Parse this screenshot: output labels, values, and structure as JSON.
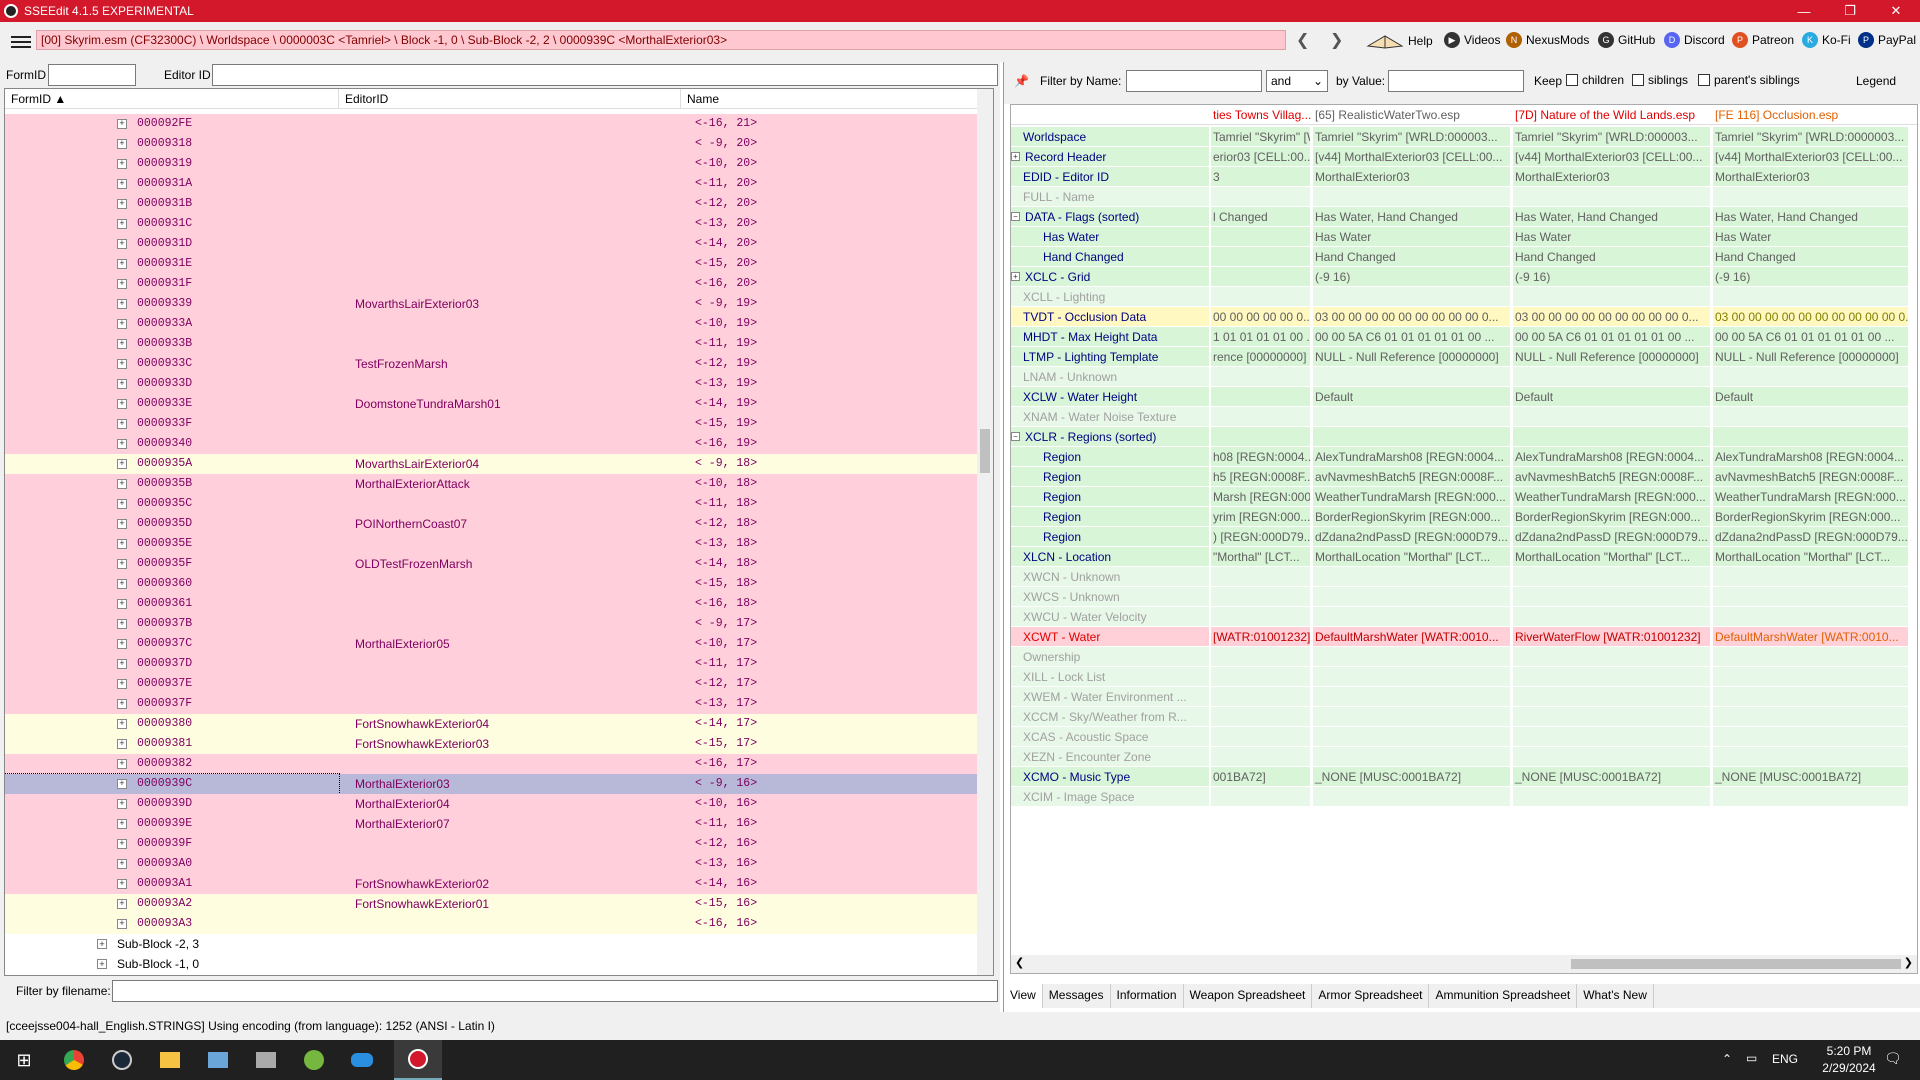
{
  "window": {
    "title": "SSEEdit 4.1.5 EXPERIMENTAL",
    "minimize": "—",
    "maximize": "❐",
    "close": "✕"
  },
  "toolbar": {
    "path": "[00] Skyrim.esm (CF32300C) \\ Worldspace \\ 0000003C <Tamriel> \\ Block -1, 0 \\ Sub-Block -2, 2 \\ 0000939C <MorthalExterior03>",
    "back": "❮",
    "forward": "❯",
    "help": "Help",
    "videos": "Videos",
    "nexus": "NexusMods",
    "github": "GitHub",
    "discord": "Discord",
    "patreon": "Patreon",
    "kofi": "Ko-Fi",
    "paypal": "PayPal"
  },
  "left": {
    "formid_label": "FormID",
    "editorid_label": "Editor ID",
    "col_formid": "FormID ▲",
    "col_editorid": "EditorID",
    "col_name": "Name",
    "rows": [
      {
        "id": "000092FE",
        "eid": "",
        "name": "<-16, 21>",
        "c": "pink"
      },
      {
        "id": "00009318",
        "eid": "",
        "name": "< -9, 20>",
        "c": "pink"
      },
      {
        "id": "00009319",
        "eid": "",
        "name": "<-10, 20>",
        "c": "pink"
      },
      {
        "id": "0000931A",
        "eid": "",
        "name": "<-11, 20>",
        "c": "pink"
      },
      {
        "id": "0000931B",
        "eid": "",
        "name": "<-12, 20>",
        "c": "pink"
      },
      {
        "id": "0000931C",
        "eid": "",
        "name": "<-13, 20>",
        "c": "pink"
      },
      {
        "id": "0000931D",
        "eid": "",
        "name": "<-14, 20>",
        "c": "pink"
      },
      {
        "id": "0000931E",
        "eid": "",
        "name": "<-15, 20>",
        "c": "pink"
      },
      {
        "id": "0000931F",
        "eid": "",
        "name": "<-16, 20>",
        "c": "pink"
      },
      {
        "id": "00009339",
        "eid": "MovarthsLairExterior03",
        "name": "< -9, 19>",
        "c": "pink"
      },
      {
        "id": "0000933A",
        "eid": "",
        "name": "<-10, 19>",
        "c": "pink"
      },
      {
        "id": "0000933B",
        "eid": "",
        "name": "<-11, 19>",
        "c": "pink"
      },
      {
        "id": "0000933C",
        "eid": "TestFrozenMarsh",
        "name": "<-12, 19>",
        "c": "pink"
      },
      {
        "id": "0000933D",
        "eid": "",
        "name": "<-13, 19>",
        "c": "pink"
      },
      {
        "id": "0000933E",
        "eid": "DoomstoneTundraMarsh01",
        "name": "<-14, 19>",
        "c": "pink"
      },
      {
        "id": "0000933F",
        "eid": "",
        "name": "<-15, 19>",
        "c": "pink"
      },
      {
        "id": "00009340",
        "eid": "",
        "name": "<-16, 19>",
        "c": "pink"
      },
      {
        "id": "0000935A",
        "eid": "MovarthsLairExterior04",
        "name": "< -9, 18>",
        "c": "yellow"
      },
      {
        "id": "0000935B",
        "eid": "MorthalExteriorAttack",
        "name": "<-10, 18>",
        "c": "pink"
      },
      {
        "id": "0000935C",
        "eid": "",
        "name": "<-11, 18>",
        "c": "pink"
      },
      {
        "id": "0000935D",
        "eid": "POINorthernCoast07",
        "name": "<-12, 18>",
        "c": "pink"
      },
      {
        "id": "0000935E",
        "eid": "",
        "name": "<-13, 18>",
        "c": "pink"
      },
      {
        "id": "0000935F",
        "eid": "OLDTestFrozenMarsh",
        "name": "<-14, 18>",
        "c": "pink"
      },
      {
        "id": "00009360",
        "eid": "",
        "name": "<-15, 18>",
        "c": "pink"
      },
      {
        "id": "00009361",
        "eid": "",
        "name": "<-16, 18>",
        "c": "pink"
      },
      {
        "id": "0000937B",
        "eid": "",
        "name": "< -9, 17>",
        "c": "pink"
      },
      {
        "id": "0000937C",
        "eid": "MorthalExterior05",
        "name": "<-10, 17>",
        "c": "pink"
      },
      {
        "id": "0000937D",
        "eid": "",
        "name": "<-11, 17>",
        "c": "pink"
      },
      {
        "id": "0000937E",
        "eid": "",
        "name": "<-12, 17>",
        "c": "pink"
      },
      {
        "id": "0000937F",
        "eid": "",
        "name": "<-13, 17>",
        "c": "pink"
      },
      {
        "id": "00009380",
        "eid": "FortSnowhawkExterior04",
        "name": "<-14, 17>",
        "c": "yellow"
      },
      {
        "id": "00009381",
        "eid": "FortSnowhawkExterior03",
        "name": "<-15, 17>",
        "c": "yellow"
      },
      {
        "id": "00009382",
        "eid": "",
        "name": "<-16, 17>",
        "c": "pink"
      },
      {
        "id": "0000939C",
        "eid": "MorthalExterior03",
        "name": "< -9, 16>",
        "c": "selected"
      },
      {
        "id": "0000939D",
        "eid": "MorthalExterior04",
        "name": "<-10, 16>",
        "c": "pink"
      },
      {
        "id": "0000939E",
        "eid": "MorthalExterior07",
        "name": "<-11, 16>",
        "c": "pink"
      },
      {
        "id": "0000939F",
        "eid": "",
        "name": "<-12, 16>",
        "c": "pink"
      },
      {
        "id": "000093A0",
        "eid": "",
        "name": "<-13, 16>",
        "c": "pink"
      },
      {
        "id": "000093A1",
        "eid": "FortSnowhawkExterior02",
        "name": "<-14, 16>",
        "c": "pink"
      },
      {
        "id": "000093A2",
        "eid": "FortSnowhawkExterior01",
        "name": "<-15, 16>",
        "c": "yellow"
      },
      {
        "id": "000093A3",
        "eid": "",
        "name": "<-16, 16>",
        "c": "yellow"
      }
    ],
    "subblocks": [
      "Sub-Block -2, 3",
      "Sub-Block -1, 0"
    ],
    "filter_label": "Filter by filename:"
  },
  "right": {
    "filter_name_label": "Filter by Name:",
    "and_select": "and",
    "by_value_label": "by Value:",
    "keep_label": "Keep",
    "children": "children",
    "siblings": "siblings",
    "parents_siblings": "parent's siblings",
    "legend": "Legend",
    "headers": [
      "ties Towns Villag...",
      "[65] RealisticWaterTwo.esp",
      "[7D] Nature of the Wild Lands.esp",
      "[FE 116] Occlusion.esp"
    ],
    "header_colors": [
      "#e00000",
      "#606060",
      "#e00000",
      "#e06000"
    ],
    "rows": [
      {
        "label": "Worldspace",
        "ind": 0,
        "exp": "",
        "v": [
          "Tamriel \"Skyrim\" [WRLD:0000003...",
          "Tamriel \"Skyrim\" [WRLD:000003...",
          "Tamriel \"Skyrim\" [WRLD:000003...",
          "Tamriel \"Skyrim\" [WRLD:0000003..."
        ],
        "bg": "#d8f5d8",
        "lc": "#000080",
        "vc": "#606060"
      },
      {
        "label": "Record Header",
        "ind": 0,
        "exp": "+",
        "v": [
          "erior03 [CELL:00...",
          "[v44] MorthalExterior03 [CELL:00...",
          "[v44] MorthalExterior03 [CELL:00...",
          "[v44] MorthalExterior03 [CELL:00..."
        ],
        "bg": "#d8f5d8",
        "lc": "#000080",
        "vc": "#606060"
      },
      {
        "label": "EDID - Editor ID",
        "ind": 0,
        "exp": "",
        "v": [
          "3",
          "MorthalExterior03",
          "MorthalExterior03",
          "MorthalExterior03"
        ],
        "bg": "#d8f5d8",
        "lc": "#000080",
        "vc": "#606060"
      },
      {
        "label": "FULL - Name",
        "ind": 0,
        "exp": "",
        "v": [
          "",
          "",
          "",
          ""
        ],
        "bg": "#e8f8e8",
        "lc": "#a0a0a0",
        "vc": "#606060"
      },
      {
        "label": "DATA - Flags (sorted)",
        "ind": 0,
        "exp": "-",
        "v": [
          "l Changed",
          "Has Water, Hand Changed",
          "Has Water, Hand Changed",
          "Has Water, Hand Changed"
        ],
        "bg": "#d8f5d8",
        "lc": "#000080",
        "vc": "#606060"
      },
      {
        "label": "Has Water",
        "ind": 1,
        "exp": "",
        "v": [
          "",
          "Has Water",
          "Has Water",
          "Has Water"
        ],
        "bg": "#d8f5d8",
        "lc": "#000080",
        "vc": "#606060"
      },
      {
        "label": "Hand Changed",
        "ind": 1,
        "exp": "",
        "v": [
          "",
          "Hand Changed",
          "Hand Changed",
          "Hand Changed"
        ],
        "bg": "#d8f5d8",
        "lc": "#000080",
        "vc": "#606060"
      },
      {
        "label": "XCLC - Grid",
        "ind": 0,
        "exp": "+",
        "v": [
          "",
          "(-9 16)",
          "(-9 16)",
          "(-9 16)"
        ],
        "bg": "#d8f5d8",
        "lc": "#000080",
        "vc": "#606060"
      },
      {
        "label": "XCLL - Lighting",
        "ind": 0,
        "exp": "",
        "v": [
          "",
          "",
          "",
          ""
        ],
        "bg": "#e8f8e8",
        "lc": "#a0a0a0",
        "vc": "#606060"
      },
      {
        "label": "TVDT - Occlusion Data",
        "ind": 0,
        "exp": "",
        "v": [
          "00 00 00 00 00 0...",
          "03 00 00 00 00 00 00 00 00 00 0...",
          "03 00 00 00 00 00 00 00 00 00 0...",
          "03 00 00 00 00 00 00 00 00 00 00 0..."
        ],
        "bg": "#fff8c0",
        "lc": "#000080",
        "vc": "#606060",
        "lastc": "#808000"
      },
      {
        "label": "MHDT - Max Height Data",
        "ind": 0,
        "exp": "",
        "v": [
          "1 01 01 01 01 00 ...",
          "00 00 5A C6 01 01 01 01 01 00 ...",
          "00 00 5A C6 01 01 01 01 01 00 ...",
          "00 00 5A C6 01 01 01 01 01 00 ..."
        ],
        "bg": "#d8f5d8",
        "lc": "#000080",
        "vc": "#606060"
      },
      {
        "label": "LTMP - Lighting Template",
        "ind": 0,
        "exp": "",
        "v": [
          "rence [00000000]",
          "NULL - Null Reference [00000000]",
          "NULL - Null Reference [00000000]",
          "NULL - Null Reference [00000000]"
        ],
        "bg": "#d8f5d8",
        "lc": "#000080",
        "vc": "#606060"
      },
      {
        "label": "LNAM - Unknown",
        "ind": 0,
        "exp": "",
        "v": [
          "",
          "",
          "",
          ""
        ],
        "bg": "#e8f8e8",
        "lc": "#a0a0a0",
        "vc": "#606060"
      },
      {
        "label": "XCLW - Water Height",
        "ind": 0,
        "exp": "",
        "v": [
          "",
          "Default",
          "Default",
          "Default"
        ],
        "bg": "#d8f5d8",
        "lc": "#000080",
        "vc": "#606060"
      },
      {
        "label": "XNAM - Water Noise Texture",
        "ind": 0,
        "exp": "",
        "v": [
          "",
          "",
          "",
          ""
        ],
        "bg": "#e8f8e8",
        "lc": "#a0a0a0",
        "vc": "#606060"
      },
      {
        "label": "XCLR - Regions (sorted)",
        "ind": 0,
        "exp": "-",
        "v": [
          "",
          "",
          "",
          ""
        ],
        "bg": "#d8f5d8",
        "lc": "#000080",
        "vc": "#606060"
      },
      {
        "label": "Region",
        "ind": 1,
        "exp": "",
        "v": [
          "h08 [REGN:0004...",
          "AlexTundraMarsh08 [REGN:0004...",
          "AlexTundraMarsh08 [REGN:0004...",
          "AlexTundraMarsh08 [REGN:0004..."
        ],
        "bg": "#d8f5d8",
        "lc": "#000080",
        "vc": "#606060"
      },
      {
        "label": "Region",
        "ind": 1,
        "exp": "",
        "v": [
          "h5 [REGN:0008F...",
          "avNavmeshBatch5 [REGN:0008F...",
          "avNavmeshBatch5 [REGN:0008F...",
          "avNavmeshBatch5 [REGN:0008F..."
        ],
        "bg": "#d8f5d8",
        "lc": "#000080",
        "vc": "#606060"
      },
      {
        "label": "Region",
        "ind": 1,
        "exp": "",
        "v": [
          "Marsh [REGN:000...",
          "WeatherTundraMarsh [REGN:000...",
          "WeatherTundraMarsh [REGN:000...",
          "WeatherTundraMarsh [REGN:000..."
        ],
        "bg": "#d8f5d8",
        "lc": "#000080",
        "vc": "#606060"
      },
      {
        "label": "Region",
        "ind": 1,
        "exp": "",
        "v": [
          "yrim [REGN:000...",
          "BorderRegionSkyrim [REGN:000...",
          "BorderRegionSkyrim [REGN:000...",
          "BorderRegionSkyrim [REGN:000..."
        ],
        "bg": "#d8f5d8",
        "lc": "#000080",
        "vc": "#606060"
      },
      {
        "label": "Region",
        "ind": 1,
        "exp": "",
        "v": [
          ") [REGN:000D79...",
          "dZdana2ndPassD [REGN:000D79...",
          "dZdana2ndPassD [REGN:000D79...",
          "dZdana2ndPassD [REGN:000D79..."
        ],
        "bg": "#d8f5d8",
        "lc": "#000080",
        "vc": "#606060"
      },
      {
        "label": "XLCN - Location",
        "ind": 0,
        "exp": "",
        "v": [
          "\"Morthal\" [LCT...",
          "MorthalLocation \"Morthal\" [LCT...",
          "MorthalLocation \"Morthal\" [LCT...",
          "MorthalLocation \"Morthal\" [LCT..."
        ],
        "bg": "#d8f5d8",
        "lc": "#000080",
        "vc": "#606060"
      },
      {
        "label": "XWCN - Unknown",
        "ind": 0,
        "exp": "",
        "v": [
          "",
          "",
          "",
          ""
        ],
        "bg": "#e8f8e8",
        "lc": "#a0a0a0",
        "vc": "#606060"
      },
      {
        "label": "XWCS - Unknown",
        "ind": 0,
        "exp": "",
        "v": [
          "",
          "",
          "",
          ""
        ],
        "bg": "#e8f8e8",
        "lc": "#a0a0a0",
        "vc": "#606060"
      },
      {
        "label": "XWCU - Water Velocity",
        "ind": 0,
        "exp": "",
        "v": [
          "",
          "",
          "",
          ""
        ],
        "bg": "#e8f8e8",
        "lc": "#a0a0a0",
        "vc": "#606060"
      },
      {
        "label": "XCWT - Water",
        "ind": 0,
        "exp": "",
        "v": [
          "[WATR:01001232]",
          "DefaultMarshWater [WATR:0010...",
          "RiverWaterFlow [WATR:01001232]",
          "DefaultMarshWater [WATR:0010..."
        ],
        "bg": "#ffd0d8",
        "lc": "#e00000",
        "vc": "#c00000",
        "lastc": "#e06000"
      },
      {
        "label": "Ownership",
        "ind": 0,
        "exp": "",
        "v": [
          "",
          "",
          "",
          ""
        ],
        "bg": "#e8f8e8",
        "lc": "#a0a0a0",
        "vc": "#606060"
      },
      {
        "label": "XILL - Lock List",
        "ind": 0,
        "exp": "",
        "v": [
          "",
          "",
          "",
          ""
        ],
        "bg": "#e8f8e8",
        "lc": "#a0a0a0",
        "vc": "#606060"
      },
      {
        "label": "XWEM - Water Environment ...",
        "ind": 0,
        "exp": "",
        "v": [
          "",
          "",
          "",
          ""
        ],
        "bg": "#e8f8e8",
        "lc": "#a0a0a0",
        "vc": "#606060"
      },
      {
        "label": "XCCM - Sky/Weather from R...",
        "ind": 0,
        "exp": "",
        "v": [
          "",
          "",
          "",
          ""
        ],
        "bg": "#e8f8e8",
        "lc": "#a0a0a0",
        "vc": "#606060"
      },
      {
        "label": "XCAS - Acoustic Space",
        "ind": 0,
        "exp": "",
        "v": [
          "",
          "",
          "",
          ""
        ],
        "bg": "#e8f8e8",
        "lc": "#a0a0a0",
        "vc": "#606060"
      },
      {
        "label": "XEZN - Encounter Zone",
        "ind": 0,
        "exp": "",
        "v": [
          "",
          "",
          "",
          ""
        ],
        "bg": "#e8f8e8",
        "lc": "#a0a0a0",
        "vc": "#606060"
      },
      {
        "label": "XCMO - Music Type",
        "ind": 0,
        "exp": "",
        "v": [
          "001BA72]",
          "_NONE [MUSC:0001BA72]",
          "_NONE [MUSC:0001BA72]",
          "_NONE [MUSC:0001BA72]"
        ],
        "bg": "#d8f5d8",
        "lc": "#000080",
        "vc": "#606060"
      },
      {
        "label": "XCIM - Image Space",
        "ind": 0,
        "exp": "",
        "v": [
          "",
          "",
          "",
          ""
        ],
        "bg": "#e8f8e8",
        "lc": "#a0a0a0",
        "vc": "#606060"
      }
    ],
    "tabs": [
      "View",
      "Messages",
      "Information",
      "Weapon Spreadsheet",
      "Armor Spreadsheet",
      "Ammunition Spreadsheet",
      "What's New"
    ]
  },
  "status": "[cceejsse004-hall_English.STRINGS] Using encoding (from language): 1252  (ANSI - Latin I)",
  "taskbar": {
    "lang": "ENG",
    "time": "5:20 PM",
    "date": "2/29/2024"
  }
}
